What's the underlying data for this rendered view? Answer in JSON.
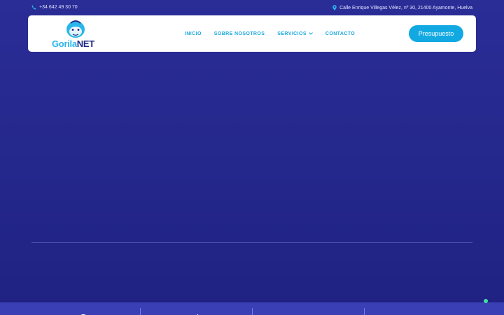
{
  "topbar": {
    "phone": "+34 642 49 30 70",
    "phone_icon": "phone-icon",
    "address": "Calle Enrique Villegas Vélez, nº 30, 21400 Ayamonte, Huelva",
    "address_icon": "map-pin-icon"
  },
  "logo": {
    "word_part1": "Gorila",
    "word_part2": "NET",
    "icon": "gorilla-logo-icon"
  },
  "nav": {
    "items": [
      {
        "label": "INICIO"
      },
      {
        "label": "SOBRE NOSOTROS"
      },
      {
        "label": "SERVICIOS"
      },
      {
        "label": "CONTACTO"
      }
    ],
    "cta": "Presupuesto"
  },
  "features": {
    "icons": [
      "box-icon",
      "check-icon",
      "location-icon",
      "chat-icon"
    ]
  },
  "colors": {
    "accent": "#12a9e3",
    "brand_dark": "#1f2a86",
    "background": "#25288d",
    "status_dot": "#3fe0a0"
  }
}
